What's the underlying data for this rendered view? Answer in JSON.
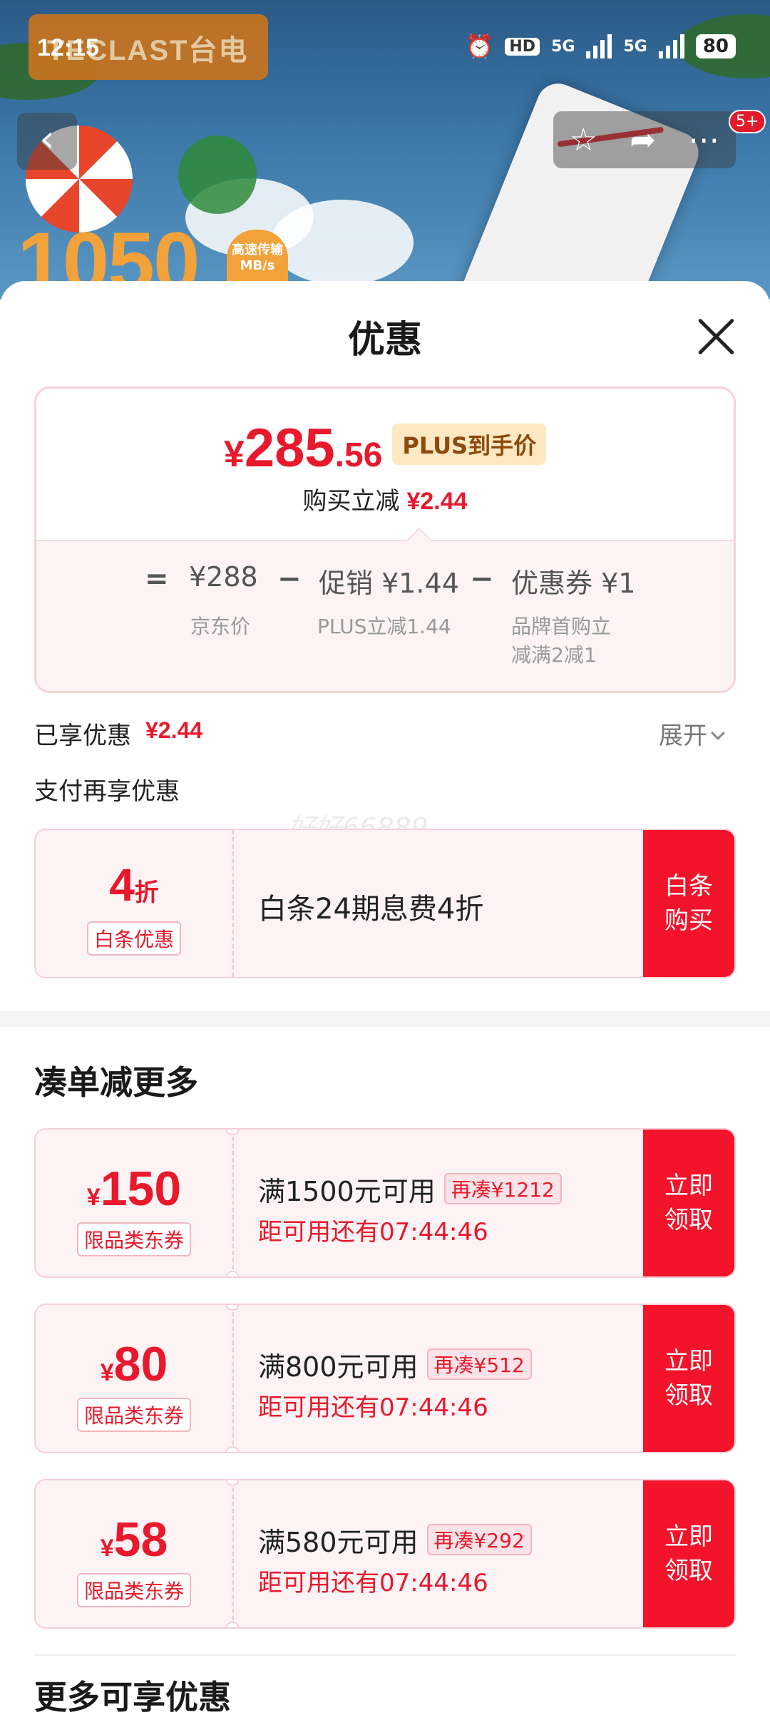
{
  "status_bar": {
    "time": "12:15",
    "hd_label": "HD",
    "net1": "5G",
    "net2": "5G",
    "battery": "80"
  },
  "hero": {
    "brand": "TECLAST台电",
    "speed": "1050",
    "speed_unit": "高速传输 MB/s",
    "nav_badge": "5+"
  },
  "sheet": {
    "title": "优惠"
  },
  "price_card": {
    "currency": "¥",
    "price_int": "285",
    "price_dec": ".56",
    "plus_tag": "PLUS到手价",
    "instant_label": "购买立减",
    "instant_value": "¥2.44",
    "formula": {
      "equals": "=",
      "jd_price": "¥288",
      "jd_price_label": "京东价",
      "minus1": "−",
      "promo": "促销 ¥1.44",
      "promo_label": "PLUS立减1.44",
      "minus2": "−",
      "coupon": "优惠券 ¥1",
      "coupon_label_1": "品牌首购立",
      "coupon_label_2": "减满2减1"
    }
  },
  "enjoyed": {
    "label": "已享优惠",
    "value": "¥2.44",
    "expand": "展开"
  },
  "pay": {
    "label": "支付再享优惠",
    "watermark": "好好66889"
  },
  "baitiao": {
    "discount_num": "4",
    "discount_unit": "折",
    "tag": "白条优惠",
    "desc": "白条24期息费4折",
    "action_1": "白条",
    "action_2": "购买"
  },
  "section_more": {
    "title": "凑单减更多"
  },
  "coupons": [
    {
      "yen": "¥",
      "amount": "150",
      "tag": "限品类东券",
      "condition": "满1500元可用",
      "more": "再凑¥1212",
      "countdown": "距可用还有07:44:46",
      "action_1": "立即",
      "action_2": "领取"
    },
    {
      "yen": "¥",
      "amount": "80",
      "tag": "限品类东券",
      "condition": "满800元可用",
      "more": "再凑¥512",
      "countdown": "距可用还有07:44:46",
      "action_1": "立即",
      "action_2": "领取"
    },
    {
      "yen": "¥",
      "amount": "58",
      "tag": "限品类东券",
      "condition": "满580元可用",
      "more": "再凑¥292",
      "countdown": "距可用还有07:44:46",
      "action_1": "立即",
      "action_2": "领取"
    }
  ],
  "section_extra": {
    "title": "更多可享优惠"
  },
  "colors": {
    "accent_red": "#e8192c",
    "action_red": "#f3132a",
    "plus_gold": "#fde8c2"
  }
}
